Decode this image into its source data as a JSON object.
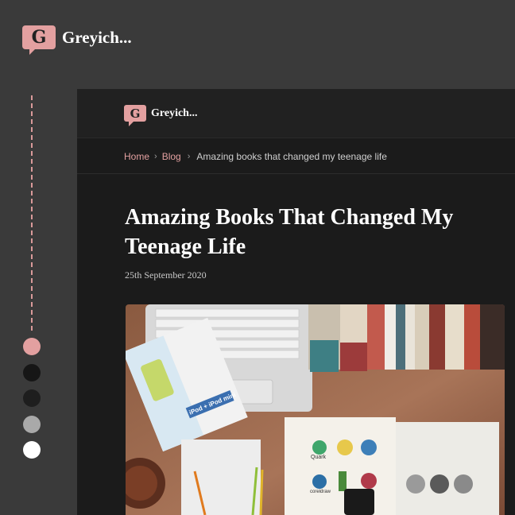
{
  "brand": {
    "letter": "G",
    "name": "Greyich..."
  },
  "breadcrumb": {
    "home": "Home",
    "blog": "Blog",
    "current": "Amazing books that changed my teenage life"
  },
  "post": {
    "title": "Amazing Books That Changed My Teenage Life",
    "date": "25th September 2020"
  },
  "hero": {
    "device_label": "iPod + iPod mini",
    "book_labels": [
      "Quark",
      "coreldraw"
    ]
  },
  "colors": {
    "accent": "#e3a0a0",
    "swatches": [
      "#e3a0a0",
      "#161616",
      "#1e1e1e",
      "#a9a9a9",
      "#ffffff"
    ]
  },
  "icons": [
    "speech-bubble-logo-icon",
    "chevron-right-icon"
  ]
}
